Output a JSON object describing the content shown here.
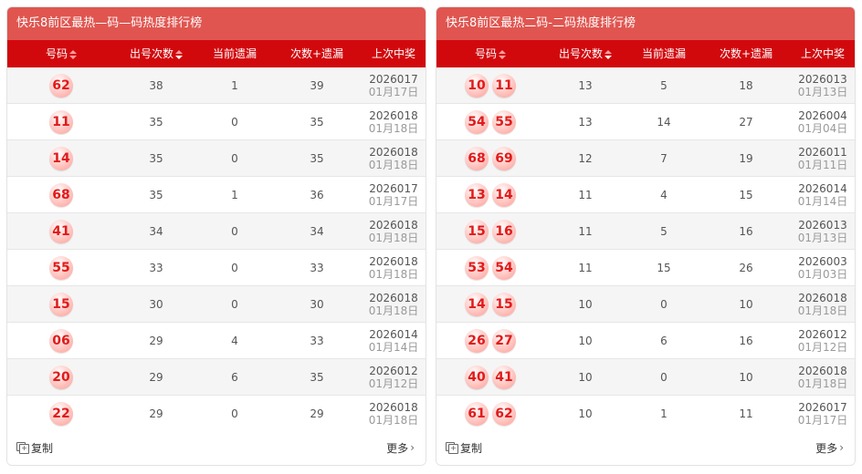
{
  "left": {
    "title": "快乐8前区最热—码—码热度排行榜",
    "headers": [
      "号码",
      "出号次数",
      "当前遗漏",
      "次数+遗漏",
      "上次中奖"
    ],
    "rows": [
      {
        "balls": [
          "62"
        ],
        "count": "38",
        "miss": "1",
        "sum": "39",
        "issue": "2026017",
        "date": "01月17日"
      },
      {
        "balls": [
          "11"
        ],
        "count": "35",
        "miss": "0",
        "sum": "35",
        "issue": "2026018",
        "date": "01月18日"
      },
      {
        "balls": [
          "14"
        ],
        "count": "35",
        "miss": "0",
        "sum": "35",
        "issue": "2026018",
        "date": "01月18日"
      },
      {
        "balls": [
          "68"
        ],
        "count": "35",
        "miss": "1",
        "sum": "36",
        "issue": "2026017",
        "date": "01月17日"
      },
      {
        "balls": [
          "41"
        ],
        "count": "34",
        "miss": "0",
        "sum": "34",
        "issue": "2026018",
        "date": "01月18日"
      },
      {
        "balls": [
          "55"
        ],
        "count": "33",
        "miss": "0",
        "sum": "33",
        "issue": "2026018",
        "date": "01月18日"
      },
      {
        "balls": [
          "15"
        ],
        "count": "30",
        "miss": "0",
        "sum": "30",
        "issue": "2026018",
        "date": "01月18日"
      },
      {
        "balls": [
          "06"
        ],
        "count": "29",
        "miss": "4",
        "sum": "33",
        "issue": "2026014",
        "date": "01月14日"
      },
      {
        "balls": [
          "20"
        ],
        "count": "29",
        "miss": "6",
        "sum": "35",
        "issue": "2026012",
        "date": "01月12日"
      },
      {
        "balls": [
          "22"
        ],
        "count": "29",
        "miss": "0",
        "sum": "29",
        "issue": "2026018",
        "date": "01月18日"
      }
    ],
    "copy_label": "复制",
    "more_label": "更多"
  },
  "right": {
    "title": "快乐8前区最热二码-二码热度排行榜",
    "headers": [
      "号码",
      "出号次数",
      "当前遗漏",
      "次数+遗漏",
      "上次中奖"
    ],
    "rows": [
      {
        "balls": [
          "10",
          "11"
        ],
        "count": "13",
        "miss": "5",
        "sum": "18",
        "issue": "2026013",
        "date": "01月13日"
      },
      {
        "balls": [
          "54",
          "55"
        ],
        "count": "13",
        "miss": "14",
        "sum": "27",
        "issue": "2026004",
        "date": "01月04日"
      },
      {
        "balls": [
          "68",
          "69"
        ],
        "count": "12",
        "miss": "7",
        "sum": "19",
        "issue": "2026011",
        "date": "01月11日"
      },
      {
        "balls": [
          "13",
          "14"
        ],
        "count": "11",
        "miss": "4",
        "sum": "15",
        "issue": "2026014",
        "date": "01月14日"
      },
      {
        "balls": [
          "15",
          "16"
        ],
        "count": "11",
        "miss": "5",
        "sum": "16",
        "issue": "2026013",
        "date": "01月13日"
      },
      {
        "balls": [
          "53",
          "54"
        ],
        "count": "11",
        "miss": "15",
        "sum": "26",
        "issue": "2026003",
        "date": "01月03日"
      },
      {
        "balls": [
          "14",
          "15"
        ],
        "count": "10",
        "miss": "0",
        "sum": "10",
        "issue": "2026018",
        "date": "01月18日"
      },
      {
        "balls": [
          "26",
          "27"
        ],
        "count": "10",
        "miss": "6",
        "sum": "16",
        "issue": "2026012",
        "date": "01月12日"
      },
      {
        "balls": [
          "40",
          "41"
        ],
        "count": "10",
        "miss": "0",
        "sum": "10",
        "issue": "2026018",
        "date": "01月18日"
      },
      {
        "balls": [
          "61",
          "62"
        ],
        "count": "10",
        "miss": "1",
        "sum": "11",
        "issue": "2026017",
        "date": "01月17日"
      }
    ],
    "copy_label": "复制",
    "more_label": "更多"
  },
  "colors": {
    "title_bar": "#e05550",
    "header_bar": "#d1090d",
    "ball_text": "#e01b1b"
  },
  "icons": [
    "sort-icon",
    "copy-icon",
    "chevron-right-icon"
  ]
}
